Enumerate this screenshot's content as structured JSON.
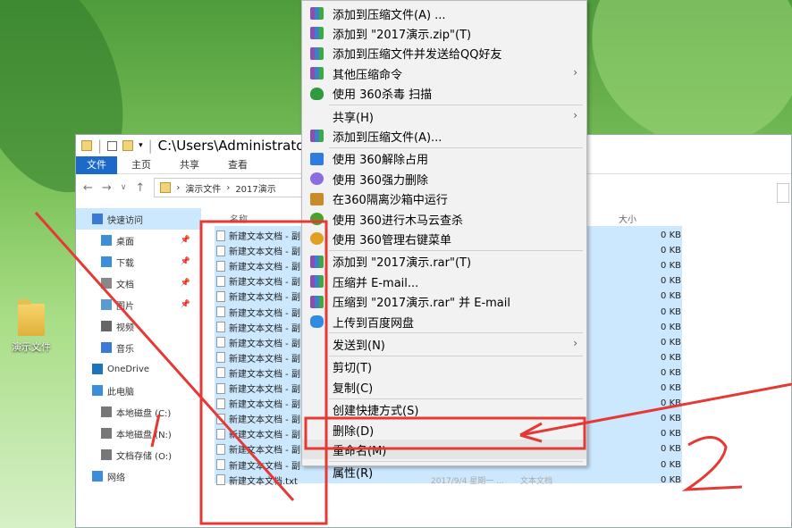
{
  "desktop": {
    "icon_label": "演示文件"
  },
  "explorer": {
    "title": "C:\\Users\\Administrato",
    "ribbon_tabs": [
      "文件",
      "主页",
      "共享",
      "查看"
    ],
    "breadcrumb": [
      "演示文件",
      "2017演示"
    ],
    "column_name": "名称",
    "column_size": "大小",
    "sidebar": [
      {
        "label": "快速访问",
        "icon": "star-icon",
        "pinned": false
      },
      {
        "label": "桌面",
        "icon": "desktop-icon",
        "pinned": true
      },
      {
        "label": "下载",
        "icon": "download-icon",
        "pinned": true
      },
      {
        "label": "文档",
        "icon": "document-icon",
        "pinned": true
      },
      {
        "label": "图片",
        "icon": "picture-icon",
        "pinned": true
      },
      {
        "label": "视频",
        "icon": "video-icon",
        "pinned": false
      },
      {
        "label": "音乐",
        "icon": "music-icon",
        "pinned": false
      },
      {
        "label": "OneDrive",
        "icon": "cloud-icon",
        "pinned": false
      },
      {
        "label": "此电脑",
        "icon": "computer-icon",
        "pinned": false
      },
      {
        "label": "本地磁盘 (C:)",
        "icon": "drive-icon",
        "pinned": false
      },
      {
        "label": "本地磁盘 (N:)",
        "icon": "drive-icon",
        "pinned": false
      },
      {
        "label": "文档存储 (O:)",
        "icon": "drive-icon",
        "pinned": false
      },
      {
        "label": "网络",
        "icon": "network-icon",
        "pinned": false
      }
    ],
    "files": [
      {
        "name": "新建文本文档 - 副",
        "size": "0 KB"
      },
      {
        "name": "新建文本文档 - 副",
        "size": "0 KB"
      },
      {
        "name": "新建文本文档 - 副",
        "size": "0 KB"
      },
      {
        "name": "新建文本文档 - 副",
        "size": "0 KB"
      },
      {
        "name": "新建文本文档 - 副",
        "size": "0 KB"
      },
      {
        "name": "新建文本文档 - 副",
        "size": "0 KB"
      },
      {
        "name": "新建文本文档 - 副",
        "size": "0 KB"
      },
      {
        "name": "新建文本文档 - 副",
        "size": "0 KB"
      },
      {
        "name": "新建文本文档 - 副",
        "size": "0 KB"
      },
      {
        "name": "新建文本文档 - 副",
        "size": "0 KB"
      },
      {
        "name": "新建文本文档 - 副",
        "size": "0 KB"
      },
      {
        "name": "新建文本文档 - 副",
        "size": "0 KB"
      },
      {
        "name": "新建文本文档 - 副",
        "size": "0 KB"
      },
      {
        "name": "新建文本文档 - 副",
        "size": "0 KB"
      },
      {
        "name": "新建文本文档 - 副",
        "size": "0 KB"
      },
      {
        "name": "新建文本文档 - 副",
        "size": "0 KB"
      },
      {
        "name": "新建文本文档.txt",
        "size": "0 KB",
        "date": "2017/9/4 星期一 ...",
        "type": "文本文档"
      }
    ]
  },
  "context_menu": [
    {
      "label": "添加到压缩文件(A) ...",
      "icon": "winrar-icon",
      "submenu": false
    },
    {
      "label": "添加到 \"2017演示.zip\"(T)",
      "icon": "winrar-icon",
      "submenu": false
    },
    {
      "label": "添加到压缩文件并发送给QQ好友",
      "icon": "winrar-icon",
      "submenu": false
    },
    {
      "label": "其他压缩命令",
      "icon": "winrar-icon",
      "submenu": true
    },
    {
      "label": "使用 360杀毒 扫描",
      "icon": "shield-icon",
      "submenu": false,
      "sep_after": true
    },
    {
      "label": "共享(H)",
      "icon": "",
      "submenu": true
    },
    {
      "label": "添加到压缩文件(A)...",
      "icon": "rar-icon",
      "submenu": false,
      "sep_after": true
    },
    {
      "label": "使用 360解除占用",
      "icon": "unlock-icon",
      "submenu": false
    },
    {
      "label": "使用 360强力删除",
      "icon": "delete-icon",
      "submenu": false
    },
    {
      "label": "在360隔离沙箱中运行",
      "icon": "sandbox-icon",
      "submenu": false
    },
    {
      "label": "使用 360进行木马云查杀",
      "icon": "trojan-scan-icon",
      "submenu": false
    },
    {
      "label": "使用 360管理右键菜单",
      "icon": "menu-manage-icon",
      "submenu": false,
      "sep_after": true
    },
    {
      "label": "添加到 \"2017演示.rar\"(T)",
      "icon": "rar-icon",
      "submenu": false
    },
    {
      "label": "压缩并 E-mail...",
      "icon": "rar-icon",
      "submenu": false
    },
    {
      "label": "压缩到 \"2017演示.rar\" 并 E-mail",
      "icon": "rar-icon",
      "submenu": false
    },
    {
      "label": "上传到百度网盘",
      "icon": "baidu-cloud-icon",
      "submenu": false,
      "sep_after": true
    },
    {
      "label": "发送到(N)",
      "icon": "",
      "submenu": true,
      "sep_after": true
    },
    {
      "label": "剪切(T)",
      "icon": "",
      "submenu": false
    },
    {
      "label": "复制(C)",
      "icon": "",
      "submenu": false,
      "sep_after": true
    },
    {
      "label": "创建快捷方式(S)",
      "icon": "",
      "submenu": false
    },
    {
      "label": "删除(D)",
      "icon": "",
      "submenu": false
    },
    {
      "label": "重命名(M)",
      "icon": "",
      "submenu": false,
      "highlighted": true,
      "sep_after": true
    },
    {
      "label": "属性(R)",
      "icon": "",
      "submenu": false
    }
  ],
  "annotations": {
    "step1": "1",
    "step2": "2",
    "color": "#e53935"
  }
}
